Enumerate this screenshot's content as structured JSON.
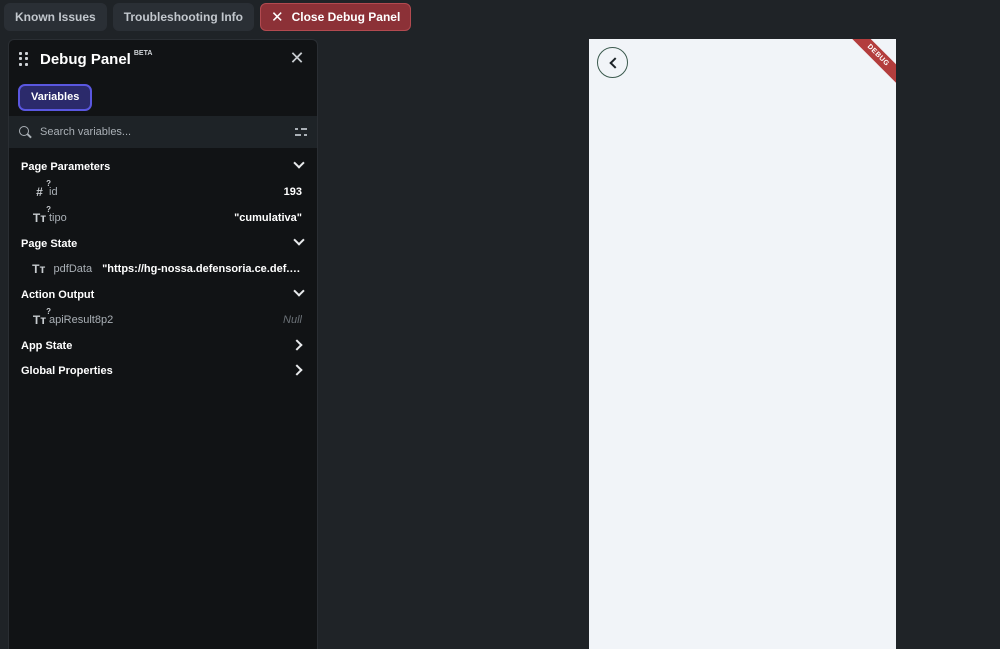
{
  "topbar": {
    "known_issues": "Known Issues",
    "troubleshooting": "Troubleshooting Info",
    "close_debug": "Close Debug Panel"
  },
  "panel": {
    "title": "Debug Panel",
    "beta": "BETA",
    "tab_variables": "Variables",
    "search_placeholder": "Search variables..."
  },
  "sections": {
    "page_parameters": "Page Parameters",
    "page_state": "Page State",
    "action_output": "Action Output",
    "app_state": "App State",
    "global_properties": "Global Properties"
  },
  "variables": {
    "id": {
      "icon": "#",
      "name": "id",
      "value": "193"
    },
    "tipo": {
      "icon": "Tт",
      "name": "tipo",
      "value": "\"cumulativa\""
    },
    "pdfData": {
      "icon": "Tт",
      "name": "pdfData",
      "value": "\"https://hg-nossa.defensoria.ce.def.br/a..."
    },
    "apiResult": {
      "icon": "Tт",
      "name": "apiResult8p2",
      "value": "Null"
    }
  },
  "device": {
    "ribbon": "DEBUG"
  }
}
